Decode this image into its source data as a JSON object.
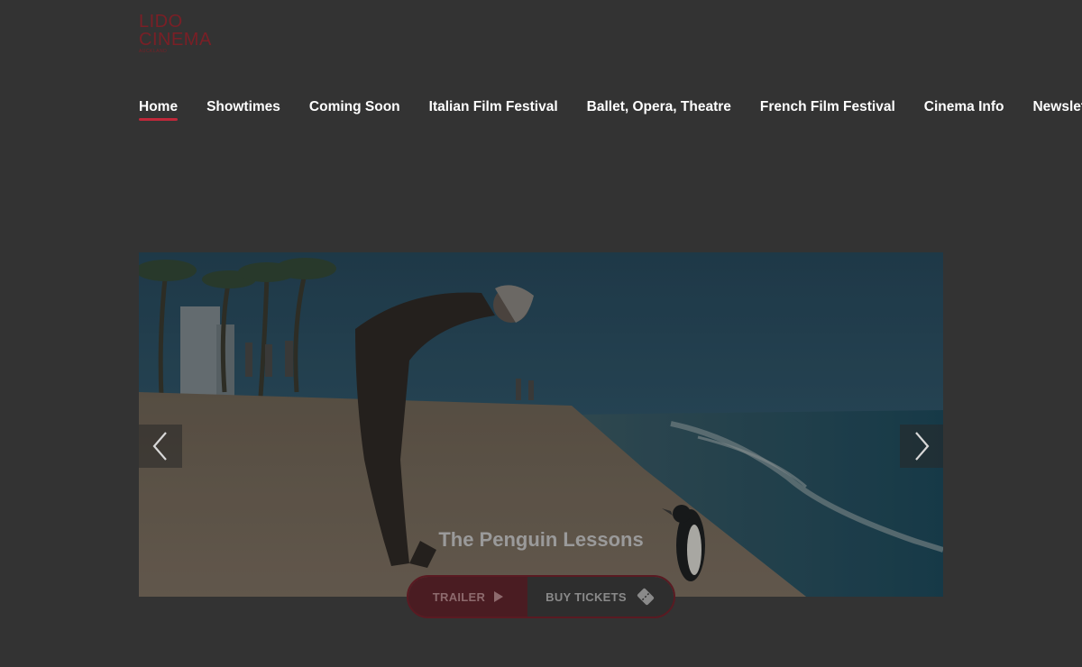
{
  "logo": {
    "line1": "LIDO",
    "line2": "CINEMA",
    "line3": "AUCKLAND"
  },
  "nav": {
    "items": [
      {
        "label": "Home",
        "active": true
      },
      {
        "label": "Showtimes"
      },
      {
        "label": "Coming Soon"
      },
      {
        "label": "Italian Film Festival"
      },
      {
        "label": "Ballet, Opera, Theatre"
      },
      {
        "label": "French Film Festival"
      },
      {
        "label": "Cinema Info"
      },
      {
        "label": "Newsletter"
      }
    ]
  },
  "hero": {
    "slide_title": "The Penguin Lessons",
    "trailer_label": "TRAILER",
    "tickets_label": "BUY TICKETS",
    "prev_icon": "chevron-left-icon",
    "next_icon": "chevron-right-icon",
    "trailer_icon": "play-icon",
    "tickets_icon": "ticket-icon"
  },
  "colors": {
    "background": "#333333",
    "accent": "#c0283a",
    "logo": "#7a1f26"
  }
}
